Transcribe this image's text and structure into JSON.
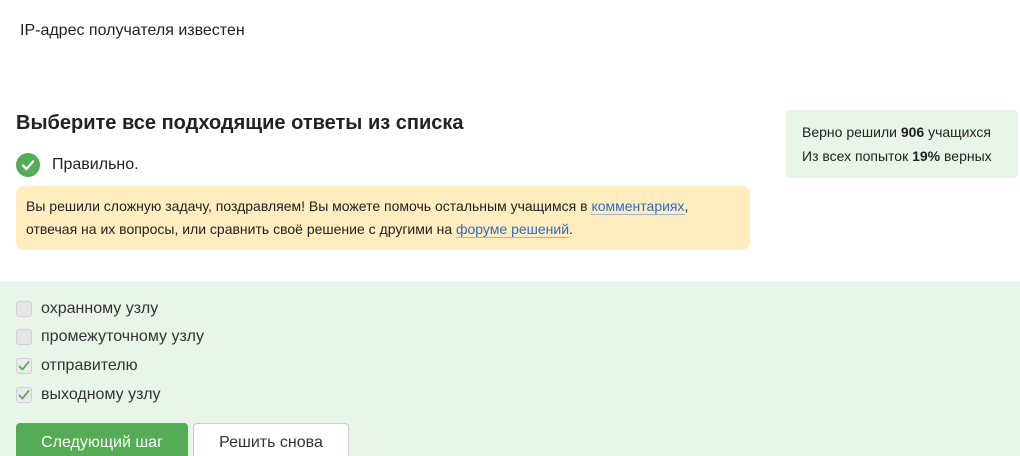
{
  "question": {
    "text": "IP-адрес получателя известен"
  },
  "task": {
    "heading": "Выберите все подходящие ответы из списка",
    "status_label": "Правильно."
  },
  "notice": {
    "text_before_link1": "Вы решили сложную задачу, поздравляем! Вы можете помочь остальным учащимся в ",
    "link1": "комментариях",
    "text_between": ", отвечая на их вопросы, или сравнить своё решение с другими на ",
    "link2": "форуме решений",
    "text_after": "."
  },
  "stats": {
    "line1_prefix": "Верно решили ",
    "solved_count": "906",
    "line1_suffix": " учащихся",
    "line2_prefix": "Из всех попыток ",
    "success_rate": "19%",
    "line2_suffix": " верных"
  },
  "options": [
    {
      "label": "охранному узлу",
      "checked": false
    },
    {
      "label": "промежуточному узлу",
      "checked": false
    },
    {
      "label": "отправителю",
      "checked": true
    },
    {
      "label": "выходному узлу",
      "checked": true
    }
  ],
  "buttons": {
    "next_label": "Следующий шаг",
    "retry_label": "Решить снова"
  },
  "colors": {
    "accent_green": "#54ad54",
    "answer_bg": "#e9f5e9",
    "notice_bg": "#ffedc0",
    "link": "#2c6bc4"
  },
  "icons": {
    "status": "check-circle-icon",
    "option_checked": "checkmark-icon"
  }
}
